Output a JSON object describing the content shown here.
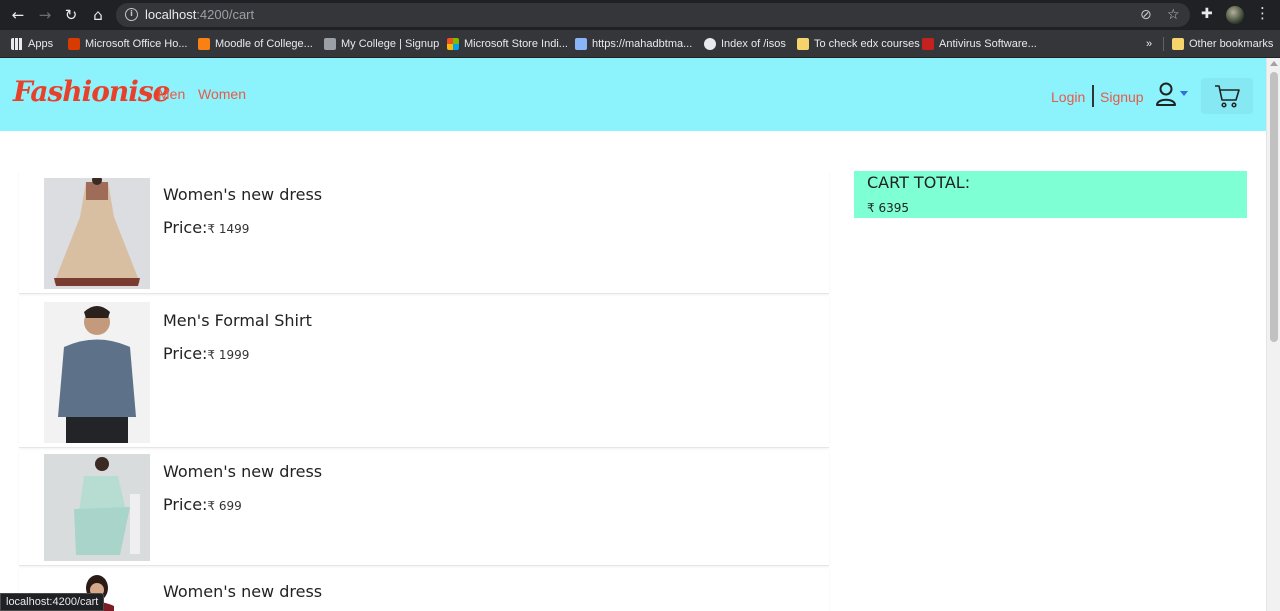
{
  "browser": {
    "url_host": "localhost",
    "url_rest": ":4200/cart",
    "bookmarks": [
      {
        "label": "Apps",
        "color": "#e8eaed"
      },
      {
        "label": "Microsoft Office Ho...",
        "color": "#d83b01"
      },
      {
        "label": "Moodle of College...",
        "color": "#f98012"
      },
      {
        "label": "My College | Signup",
        "color": "#9aa0a6"
      },
      {
        "label": "Microsoft Store Indi...",
        "color": "#7fba00"
      },
      {
        "label": "https://mahadbtma...",
        "color": "#8ab4f8"
      },
      {
        "label": "Index of /isos",
        "color": "#e8eaed"
      },
      {
        "label": "To check edx courses",
        "color": "#f6d36b"
      },
      {
        "label": "Antivirus Software...",
        "color": "#c5221f"
      }
    ],
    "more_label": "»",
    "other_bookmarks": "Other bookmarks",
    "status_url": "localhost:4200/cart"
  },
  "navbar": {
    "logo": "Fashionise",
    "links": [
      "Men",
      "Women"
    ],
    "login": "Login",
    "signup": "Signup",
    "accent": "#8cf3fd"
  },
  "cart": {
    "items": [
      {
        "title": "Women's new dress",
        "price_label": "Price:",
        "price": "₹ 1499"
      },
      {
        "title": "Men's Formal Shirt",
        "price_label": "Price:",
        "price": "₹ 1999"
      },
      {
        "title": "Women's new dress",
        "price_label": "Price:",
        "price": "₹ 699"
      },
      {
        "title": "Women's new dress",
        "price_label": "Price:",
        "price": ""
      }
    ],
    "total_title": "CART TOTAL:",
    "total_value": "₹ 6395",
    "total_bg": "#7effd4"
  }
}
